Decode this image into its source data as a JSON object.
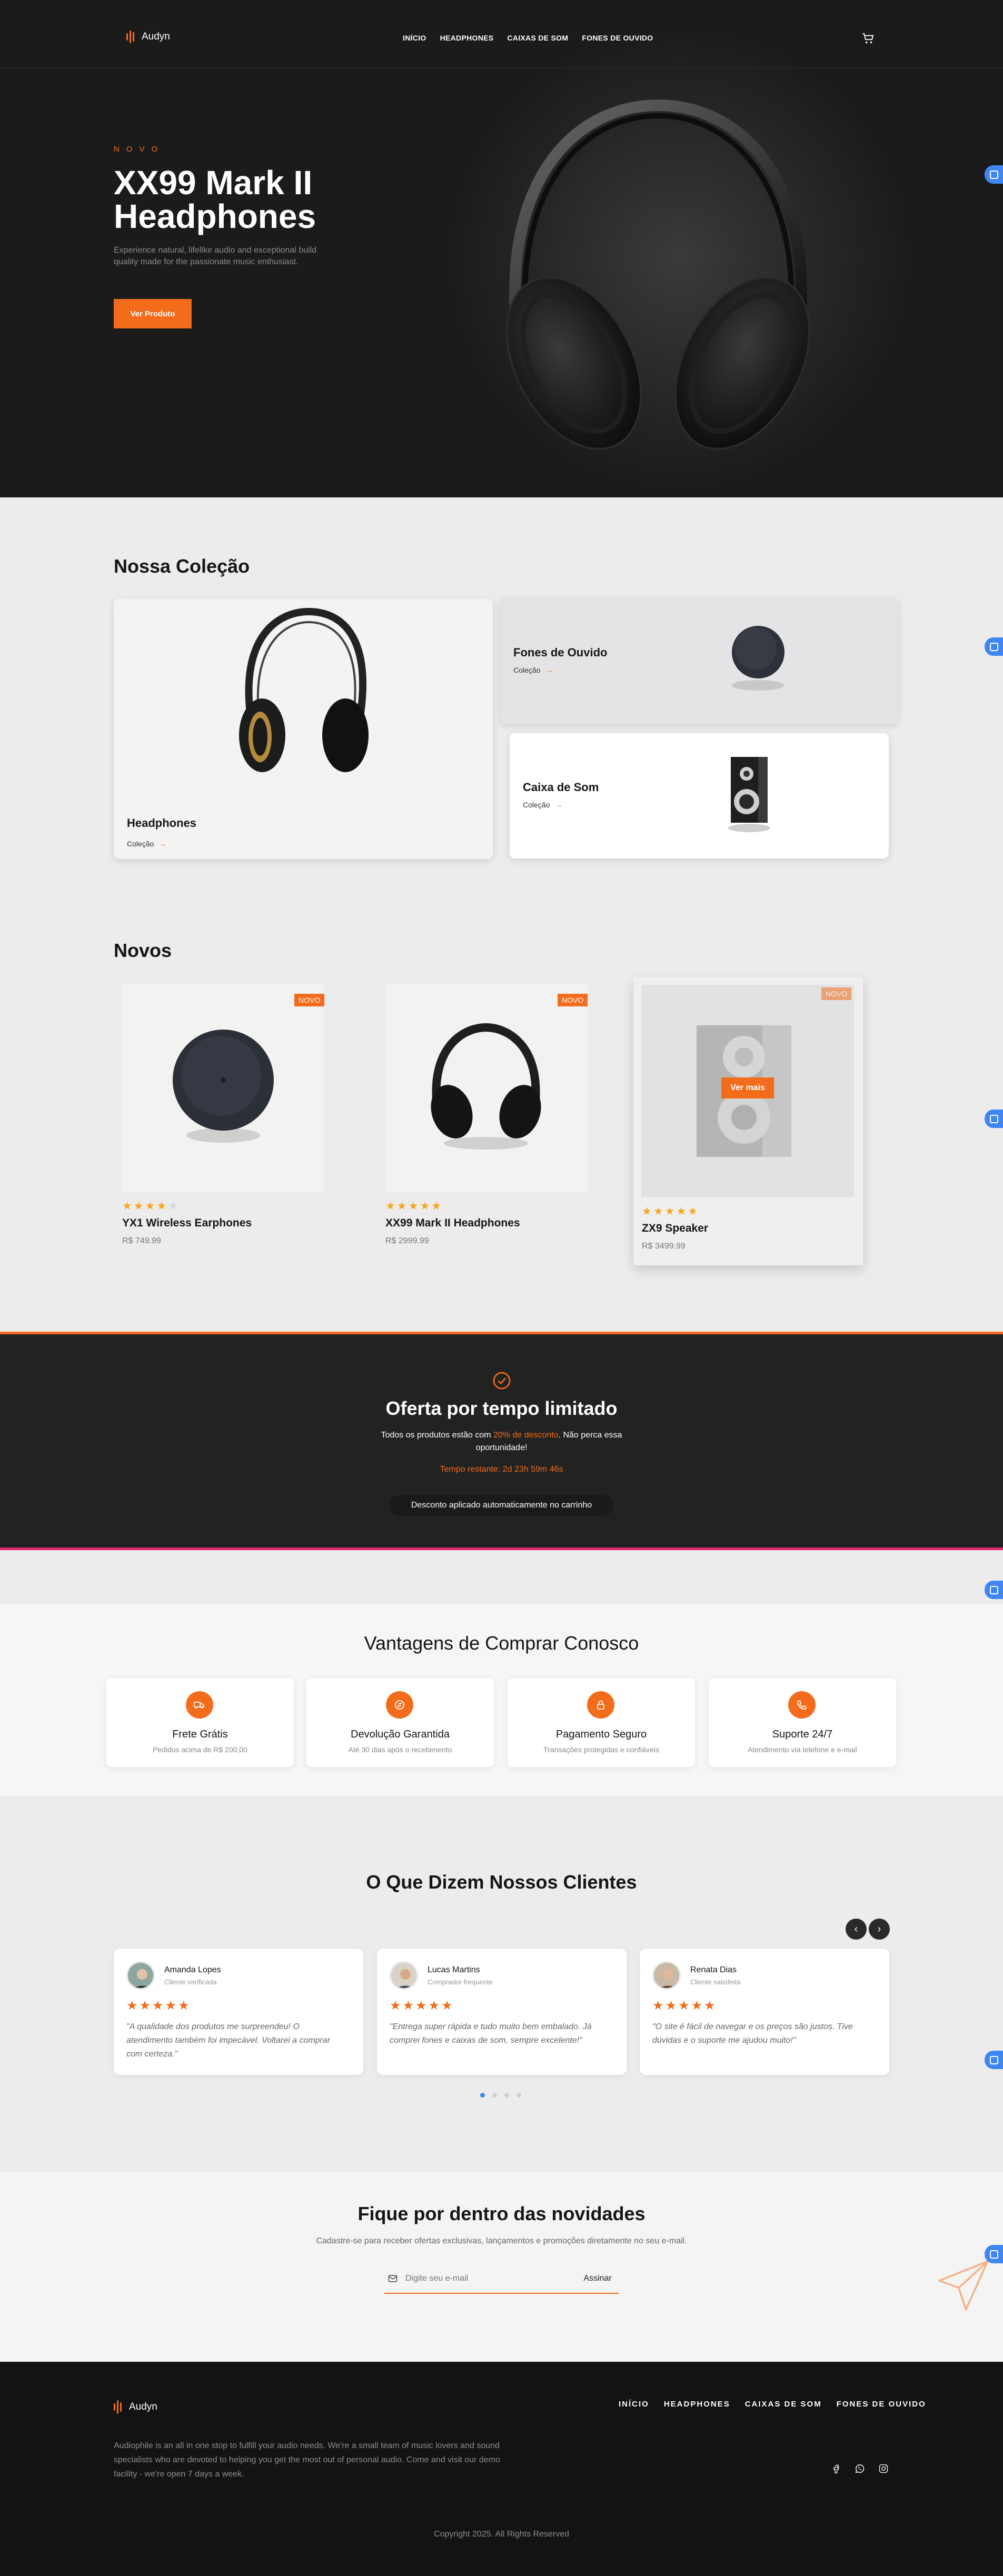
{
  "brand": {
    "name": "Audyn",
    "accent": "#f26c1b",
    "dark": "#1b1b1b"
  },
  "nav": {
    "items": [
      "INÍCIO",
      "HEADPHONES",
      "CAIXAS DE SOM",
      "FONES DE OUVIDO"
    ],
    "cart_icon": "cart-icon"
  },
  "hero": {
    "eyebrow": "NOVO",
    "title": "XX99 Mark II Headphones",
    "description": "Experience natural, lifelike audio and exceptional build quality made for the passionate music enthusiast.",
    "cta": "Ver Produto"
  },
  "collection": {
    "heading": "Nossa Coleção",
    "items": [
      {
        "title": "Headphones",
        "link": "Coleção"
      },
      {
        "title": "Fones de Ouvido",
        "link": "Coleção"
      },
      {
        "title": "Caixa de Som",
        "link": "Coleção"
      }
    ],
    "link_arrow": "→"
  },
  "new_products": {
    "heading": "Novos",
    "badge": "NOVO",
    "hover_label": "Ver mais",
    "items": [
      {
        "name": "YX1 Wireless Earphones",
        "price": "R$ 749.99",
        "rating": 4
      },
      {
        "name": "XX99 Mark II Headphones",
        "price": "R$ 2999.99",
        "rating": 5
      },
      {
        "name": "ZX9 Speaker",
        "price": "R$ 3499.99",
        "rating": 5
      }
    ]
  },
  "offer": {
    "title": "Oferta por tempo limitado",
    "text_before": "Todos os produtos estão com ",
    "highlight": "20% de desconto",
    "text_after": ". Não perca essa oportunidade!",
    "countdown": "Tempo restante: 2d 23h 59m 46s",
    "pill": "Desconto aplicado automaticamente no carrinho"
  },
  "advantages": {
    "heading": "Vantagens de Comprar Conosco",
    "items": [
      {
        "title": "Frete Grátis",
        "subtitle": "Pedidos acima de R$ 200,00",
        "icon": "truck-icon"
      },
      {
        "title": "Devolução Garantida",
        "subtitle": "Até 30 dias após o recebimento",
        "icon": "return-icon"
      },
      {
        "title": "Pagamento Seguro",
        "subtitle": "Transações protegidas e confiáveis",
        "icon": "lock-icon"
      },
      {
        "title": "Suporte 24/7",
        "subtitle": "Atendimento via telefone e e-mail",
        "icon": "phone-icon"
      }
    ]
  },
  "testimonials": {
    "heading": "O Que Dizem Nossos Clientes",
    "prev": "‹",
    "next": "›",
    "items": [
      {
        "name": "Amanda Lopes",
        "role": "Cliente verificada",
        "rating": 5,
        "text": "\"A qualidade dos produtos me surpreendeu! O atendimento também foi impecável. Voltarei a comprar com certeza.\""
      },
      {
        "name": "Lucas Martins",
        "role": "Comprador frequente",
        "rating": 5,
        "text": "\"Entrega super rápida e tudo muito bem embalado. Já comprei fones e caixas de som, sempre excelente!\""
      },
      {
        "name": "Renata Dias",
        "role": "Cliente satisfeita",
        "rating": 5,
        "text": "\"O site é fácil de navegar e os preços são justos. Tive dúvidas e o suporte me ajudou muito!\""
      }
    ],
    "active_page": 1,
    "pages": 4
  },
  "newsletter": {
    "heading": "Fique por dentro das novidades",
    "subtitle": "Cadastre-se para receber ofertas exclusivas, lançamentos e promoções diretamente no seu e-mail.",
    "placeholder": "Digite seu e-mail",
    "button": "Assinar"
  },
  "footer": {
    "links": [
      "INÍCIO",
      "HEADPHONES",
      "CAIXAS DE SOM",
      "FONES DE OUVIDO"
    ],
    "about": "Audiophile is an all in one stop to fulfill your audio needs. We're a small team of music lovers and sound specialists who are devoted to helping you get the most out of personal audio. Come and visit our demo facility - we're open 7 days a week.",
    "social": [
      "facebook-icon",
      "whatsapp-icon",
      "instagram-icon"
    ],
    "copyright": "Copyright 2025. All Rights Reserved"
  }
}
